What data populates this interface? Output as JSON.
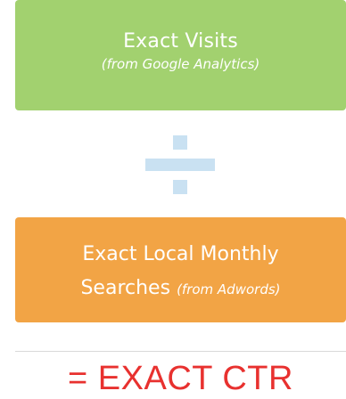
{
  "numerator": {
    "title": "Exact Visits",
    "source": "(from Google Analytics)",
    "color": "#a2d16f"
  },
  "operator": {
    "icon": "division-icon",
    "color": "#c9e1f2"
  },
  "denominator": {
    "line1": "Exact Local Monthly",
    "line2": "Searches",
    "source": "(from Adwords)",
    "color": "#f2a445"
  },
  "result": {
    "text": "= EXACT CTR",
    "color": "#e8312f"
  }
}
